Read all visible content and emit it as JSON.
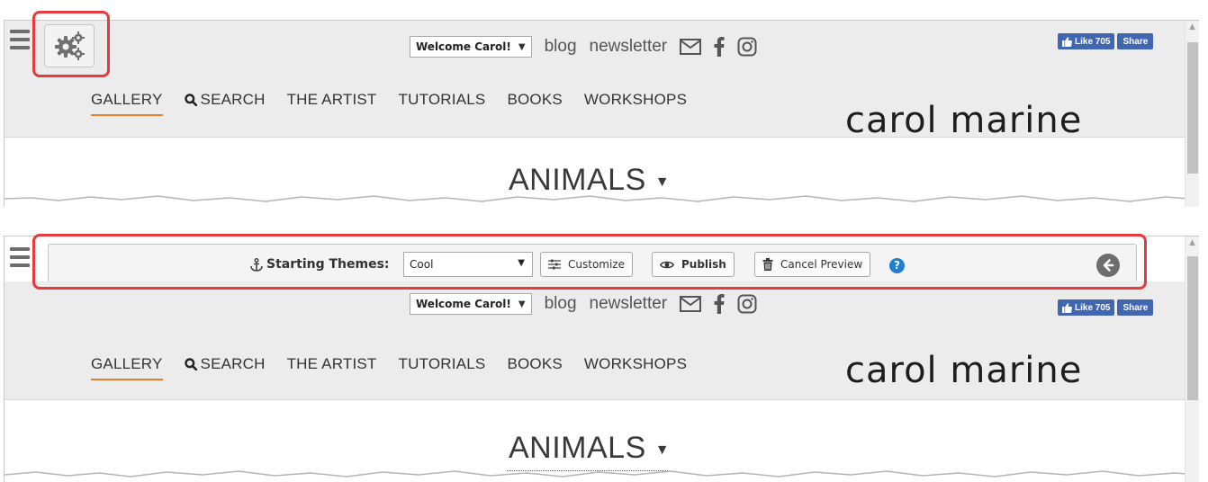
{
  "site": {
    "welcome_label": "Welcome Carol!",
    "blog_label": "blog",
    "newsletter_label": "newsletter",
    "facebook_like_label": "Like 705",
    "facebook_share_label": "Share",
    "logo_text": "carol marine",
    "nav": [
      "GALLERY",
      "SEARCH",
      "THE ARTIST",
      "TUTORIALS",
      "BOOKS",
      "WORKSHOPS"
    ],
    "active_nav": "GALLERY",
    "page_title": "ANIMALS"
  },
  "theme_toolbar": {
    "label": "Starting Themes:",
    "selected_theme": "Cool",
    "customize_label": "Customize",
    "publish_label": "Publish",
    "cancel_label": "Cancel Preview",
    "help_label": "?"
  },
  "icons": [
    "hamburger-icon",
    "gears-icon",
    "envelope-icon",
    "facebook-icon",
    "instagram-icon",
    "search-icon",
    "anchor-icon",
    "sliders-icon",
    "eye-icon",
    "trash-icon",
    "help-icon",
    "back-arrow-icon",
    "thumbs-up-icon",
    "caret-down-icon"
  ],
  "colors": {
    "highlight": "#e8393c",
    "nav_active_underline": "#f07b28",
    "facebook": "#4267b2",
    "help": "#1f7fd0"
  }
}
